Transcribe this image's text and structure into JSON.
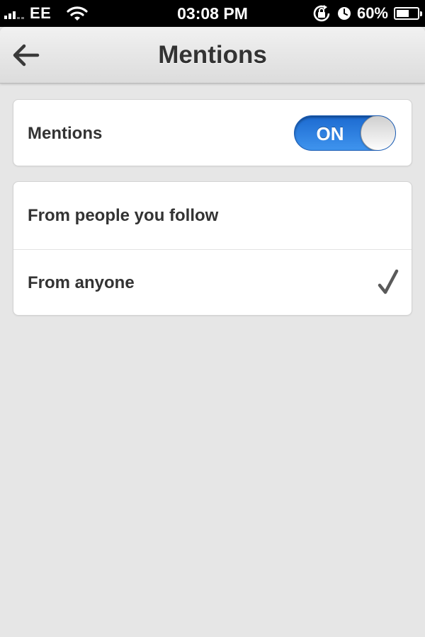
{
  "status_bar": {
    "carrier": "EE",
    "time": "03:08 PM",
    "battery_percent": "60%",
    "battery_level": 0.6,
    "icons": [
      "signal-icon",
      "wifi-icon",
      "rotation-lock-icon",
      "alarm-icon",
      "battery-icon"
    ]
  },
  "header": {
    "title": "Mentions",
    "back_icon": "back-arrow-icon"
  },
  "mentions_setting": {
    "label": "Mentions",
    "toggle_state": "ON",
    "enabled": true
  },
  "options": [
    {
      "label": "From people you follow",
      "selected": false
    },
    {
      "label": "From anyone",
      "selected": true
    }
  ],
  "colors": {
    "accent": "#2f7fe0",
    "background": "#e6e6e6",
    "text": "#333333"
  }
}
